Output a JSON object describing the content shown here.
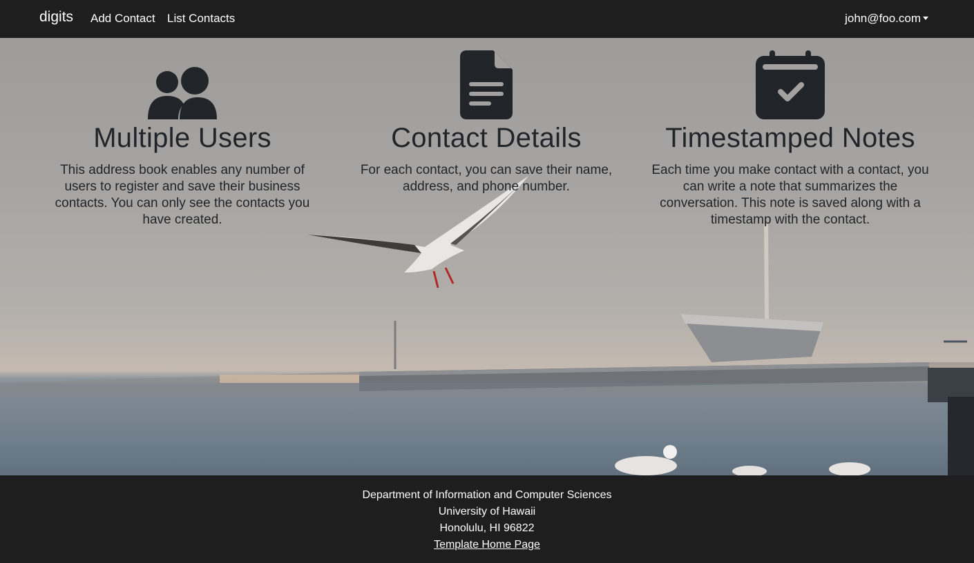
{
  "navbar": {
    "brand": "digits",
    "links": [
      "Add Contact",
      "List Contacts"
    ],
    "user": "john@foo.com"
  },
  "features": [
    {
      "icon": "users-icon",
      "title": "Multiple Users",
      "text": "This address book enables any number of users to register and save their business contacts. You can only see the contacts you have created."
    },
    {
      "icon": "file-text-icon",
      "title": "Contact Details",
      "text": "For each contact, you can save their name, address, and phone number."
    },
    {
      "icon": "calendar-check-icon",
      "title": "Timestamped Notes",
      "text": "Each time you make contact with a contact, you can write a note that summarizes the conversation. This note is saved along with a timestamp with the contact."
    }
  ],
  "footer": {
    "lines": [
      "Department of Information and Computer Sciences",
      "University of Hawaii",
      "Honolulu, HI 96822"
    ],
    "link": "Template Home Page"
  },
  "colors": {
    "navbar_bg": "#1e1e1e",
    "text_dark": "#212529",
    "white": "#ffffff"
  }
}
